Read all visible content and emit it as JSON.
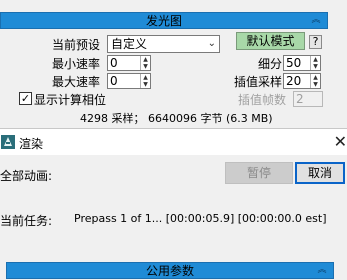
{
  "glow_rollout": {
    "title": "发光图",
    "collapse_icon": "double-chevron-up-icon",
    "current_preset_label": "当前预设",
    "current_preset_value": "自定义",
    "default_mode_button": "默认模式",
    "help_button": "?",
    "min_rate_label": "最小速率",
    "min_rate_value": "0",
    "max_rate_label": "最大速率",
    "max_rate_value": "0",
    "subdivs_label": "细分",
    "subdivs_value": "50",
    "interp_samples_label": "插值采样",
    "interp_samples_value": "20",
    "show_calc_phase_label": "显示计算相位",
    "show_calc_phase_checked": true,
    "interp_frames_label": "插值帧数",
    "interp_frames_value": "2",
    "stats_text": "4298 采样；  6640096 字节 (6.3 MB)"
  },
  "render_dialog": {
    "title": "渲染",
    "close_icon": "close-icon",
    "all_animation_label": "全部动画:",
    "pause_button": "暂停",
    "cancel_button": "取消",
    "current_task_label": "当前任务:",
    "current_task_value": "Prepass 1 of 1... [00:00:05.9] [00:00:00.0 est]"
  },
  "common_rollout": {
    "title": "公用参数",
    "collapse_icon": "double-chevron-up-icon"
  },
  "colors": {
    "rollout_header": "#1f8bd6",
    "cancel_focus": "#0a64c8",
    "default_mode_green": "#a8d8a8"
  }
}
